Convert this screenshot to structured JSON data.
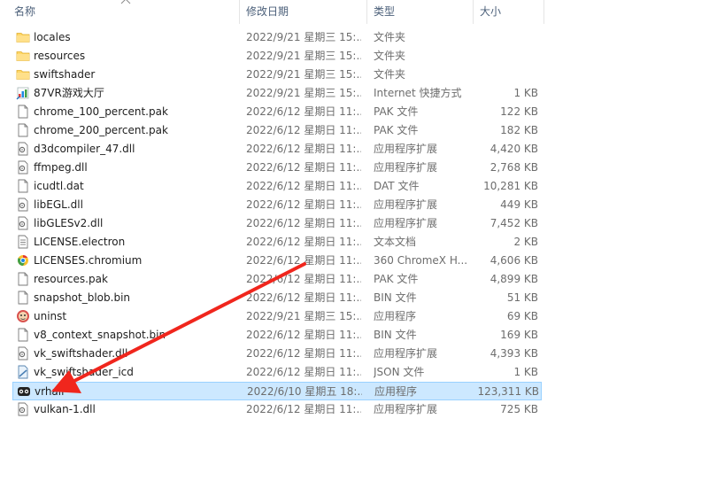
{
  "columns": {
    "name": "名称",
    "date": "修改日期",
    "type": "类型",
    "size": "大小"
  },
  "colors": {
    "selected_bg": "#cce8ff",
    "selected_border": "#99d1ff",
    "folder": "#ffd766",
    "arrow": "#f0261d"
  },
  "files": [
    {
      "name": "locales",
      "date": "2022/9/21 星期三 15:...",
      "type": "文件夹",
      "size": "",
      "icon": "folder-icon"
    },
    {
      "name": "resources",
      "date": "2022/9/21 星期三 15:...",
      "type": "文件夹",
      "size": "",
      "icon": "folder-icon"
    },
    {
      "name": "swiftshader",
      "date": "2022/9/21 星期三 15:...",
      "type": "文件夹",
      "size": "",
      "icon": "folder-icon"
    },
    {
      "name": "87VR游戏大厅",
      "date": "2022/9/21 星期三 15:...",
      "type": "Internet 快捷方式",
      "size": "1 KB",
      "icon": "internet-shortcut-icon"
    },
    {
      "name": "chrome_100_percent.pak",
      "date": "2022/6/12 星期日 11:...",
      "type": "PAK 文件",
      "size": "122 KB",
      "icon": "file-icon"
    },
    {
      "name": "chrome_200_percent.pak",
      "date": "2022/6/12 星期日 11:...",
      "type": "PAK 文件",
      "size": "182 KB",
      "icon": "file-icon"
    },
    {
      "name": "d3dcompiler_47.dll",
      "date": "2022/6/12 星期日 11:...",
      "type": "应用程序扩展",
      "size": "4,420 KB",
      "icon": "dll-icon"
    },
    {
      "name": "ffmpeg.dll",
      "date": "2022/6/12 星期日 11:...",
      "type": "应用程序扩展",
      "size": "2,768 KB",
      "icon": "dll-icon"
    },
    {
      "name": "icudtl.dat",
      "date": "2022/6/12 星期日 11:...",
      "type": "DAT 文件",
      "size": "10,281 KB",
      "icon": "file-icon"
    },
    {
      "name": "libEGL.dll",
      "date": "2022/6/12 星期日 11:...",
      "type": "应用程序扩展",
      "size": "449 KB",
      "icon": "dll-icon"
    },
    {
      "name": "libGLESv2.dll",
      "date": "2022/6/12 星期日 11:...",
      "type": "应用程序扩展",
      "size": "7,452 KB",
      "icon": "dll-icon"
    },
    {
      "name": "LICENSE.electron",
      "date": "2022/6/12 星期日 11:...",
      "type": "文本文档",
      "size": "2 KB",
      "icon": "text-file-icon"
    },
    {
      "name": "LICENSES.chromium",
      "date": "2022/6/12 星期日 11:...",
      "type": "360 ChromeX H...",
      "size": "4,606 KB",
      "icon": "chrome-html-icon"
    },
    {
      "name": "resources.pak",
      "date": "2022/6/12 星期日 11:...",
      "type": "PAK 文件",
      "size": "4,899 KB",
      "icon": "file-icon"
    },
    {
      "name": "snapshot_blob.bin",
      "date": "2022/6/12 星期日 11:...",
      "type": "BIN 文件",
      "size": "51 KB",
      "icon": "file-icon"
    },
    {
      "name": "uninst",
      "date": "2022/9/21 星期三 15:...",
      "type": "应用程序",
      "size": "69 KB",
      "icon": "uninstall-app-icon"
    },
    {
      "name": "v8_context_snapshot.bin",
      "date": "2022/6/12 星期日 11:...",
      "type": "BIN 文件",
      "size": "169 KB",
      "icon": "file-icon"
    },
    {
      "name": "vk_swiftshader.dll",
      "date": "2022/6/12 星期日 11:...",
      "type": "应用程序扩展",
      "size": "4,393 KB",
      "icon": "dll-icon"
    },
    {
      "name": "vk_swiftshader_icd",
      "date": "2022/6/12 星期日 11:...",
      "type": "JSON 文件",
      "size": "1 KB",
      "icon": "json-file-icon"
    },
    {
      "name": "vrhall",
      "date": "2022/6/10 星期五 18:...",
      "type": "应用程序",
      "size": "123,311 KB",
      "icon": "vr-app-icon",
      "selected": true
    },
    {
      "name": "vulkan-1.dll",
      "date": "2022/6/12 星期日 11:...",
      "type": "应用程序扩展",
      "size": "725 KB",
      "icon": "dll-icon"
    }
  ]
}
